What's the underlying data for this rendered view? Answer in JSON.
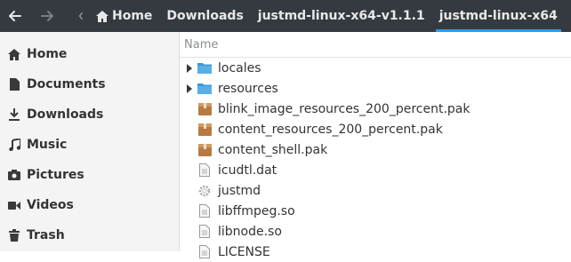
{
  "toolbar": {
    "back_icon": "arrow-left-icon",
    "forward_icon": "arrow-right-icon",
    "path_toggle_icon": "chevron-left-icon"
  },
  "breadcrumbs": [
    {
      "label": "Home",
      "icon": "home-icon"
    },
    {
      "label": "Downloads"
    },
    {
      "label": "justmd-linux-x64-v1.1.1"
    },
    {
      "label": "justmd-linux-x64",
      "active": true
    }
  ],
  "sidebar": {
    "items": [
      {
        "label": "Home",
        "icon": "home-icon"
      },
      {
        "label": "Documents",
        "icon": "document-icon"
      },
      {
        "label": "Downloads",
        "icon": "download-icon"
      },
      {
        "label": "Music",
        "icon": "music-icon"
      },
      {
        "label": "Pictures",
        "icon": "camera-icon"
      },
      {
        "label": "Videos",
        "icon": "video-icon"
      },
      {
        "label": "Trash",
        "icon": "trash-icon"
      }
    ]
  },
  "list": {
    "column_name": "Name",
    "rows": [
      {
        "name": "locales",
        "type": "folder"
      },
      {
        "name": "resources",
        "type": "folder"
      },
      {
        "name": "blink_image_resources_200_percent.pak",
        "type": "package"
      },
      {
        "name": "content_resources_200_percent.pak",
        "type": "package"
      },
      {
        "name": "content_shell.pak",
        "type": "package"
      },
      {
        "name": "icudtl.dat",
        "type": "document"
      },
      {
        "name": "justmd",
        "type": "executable"
      },
      {
        "name": "libffmpeg.so",
        "type": "document"
      },
      {
        "name": "libnode.so",
        "type": "document"
      },
      {
        "name": "LICENSE",
        "type": "document"
      }
    ]
  },
  "colors": {
    "header_bg": "#353a40",
    "accent": "#2a9df4",
    "folder": "#3f97d6",
    "package": "#b77a43"
  }
}
